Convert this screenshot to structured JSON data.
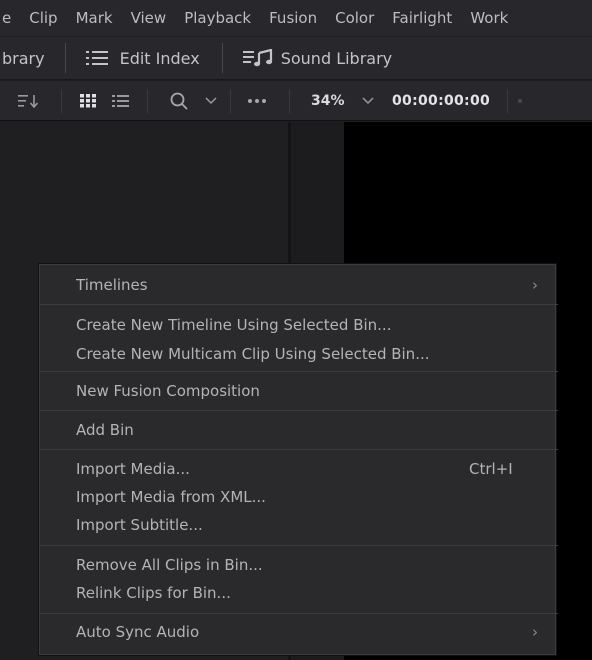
{
  "menubar": {
    "items": [
      "e",
      "Clip",
      "Mark",
      "View",
      "Playback",
      "Fusion",
      "Color",
      "Fairlight",
      "Work"
    ]
  },
  "toolbar": {
    "library_label": "brary",
    "edit_index_label": "Edit Index",
    "sound_library_label": "Sound Library"
  },
  "subbar": {
    "zoom_value": "34%",
    "timecode": "00:00:00:00"
  },
  "context_menu": {
    "timelines": "Timelines",
    "create_timeline": "Create New Timeline Using Selected Bin...",
    "create_multicam": "Create New Multicam Clip Using Selected Bin...",
    "new_fusion": "New Fusion Composition",
    "add_bin": "Add Bin",
    "import_media": "Import Media...",
    "import_media_shortcut": "Ctrl+I",
    "import_xml": "Import Media from XML...",
    "import_subtitle": "Import Subtitle...",
    "remove_clips": "Remove All Clips in Bin...",
    "relink_clips": "Relink Clips for Bin...",
    "auto_sync": "Auto Sync Audio"
  }
}
